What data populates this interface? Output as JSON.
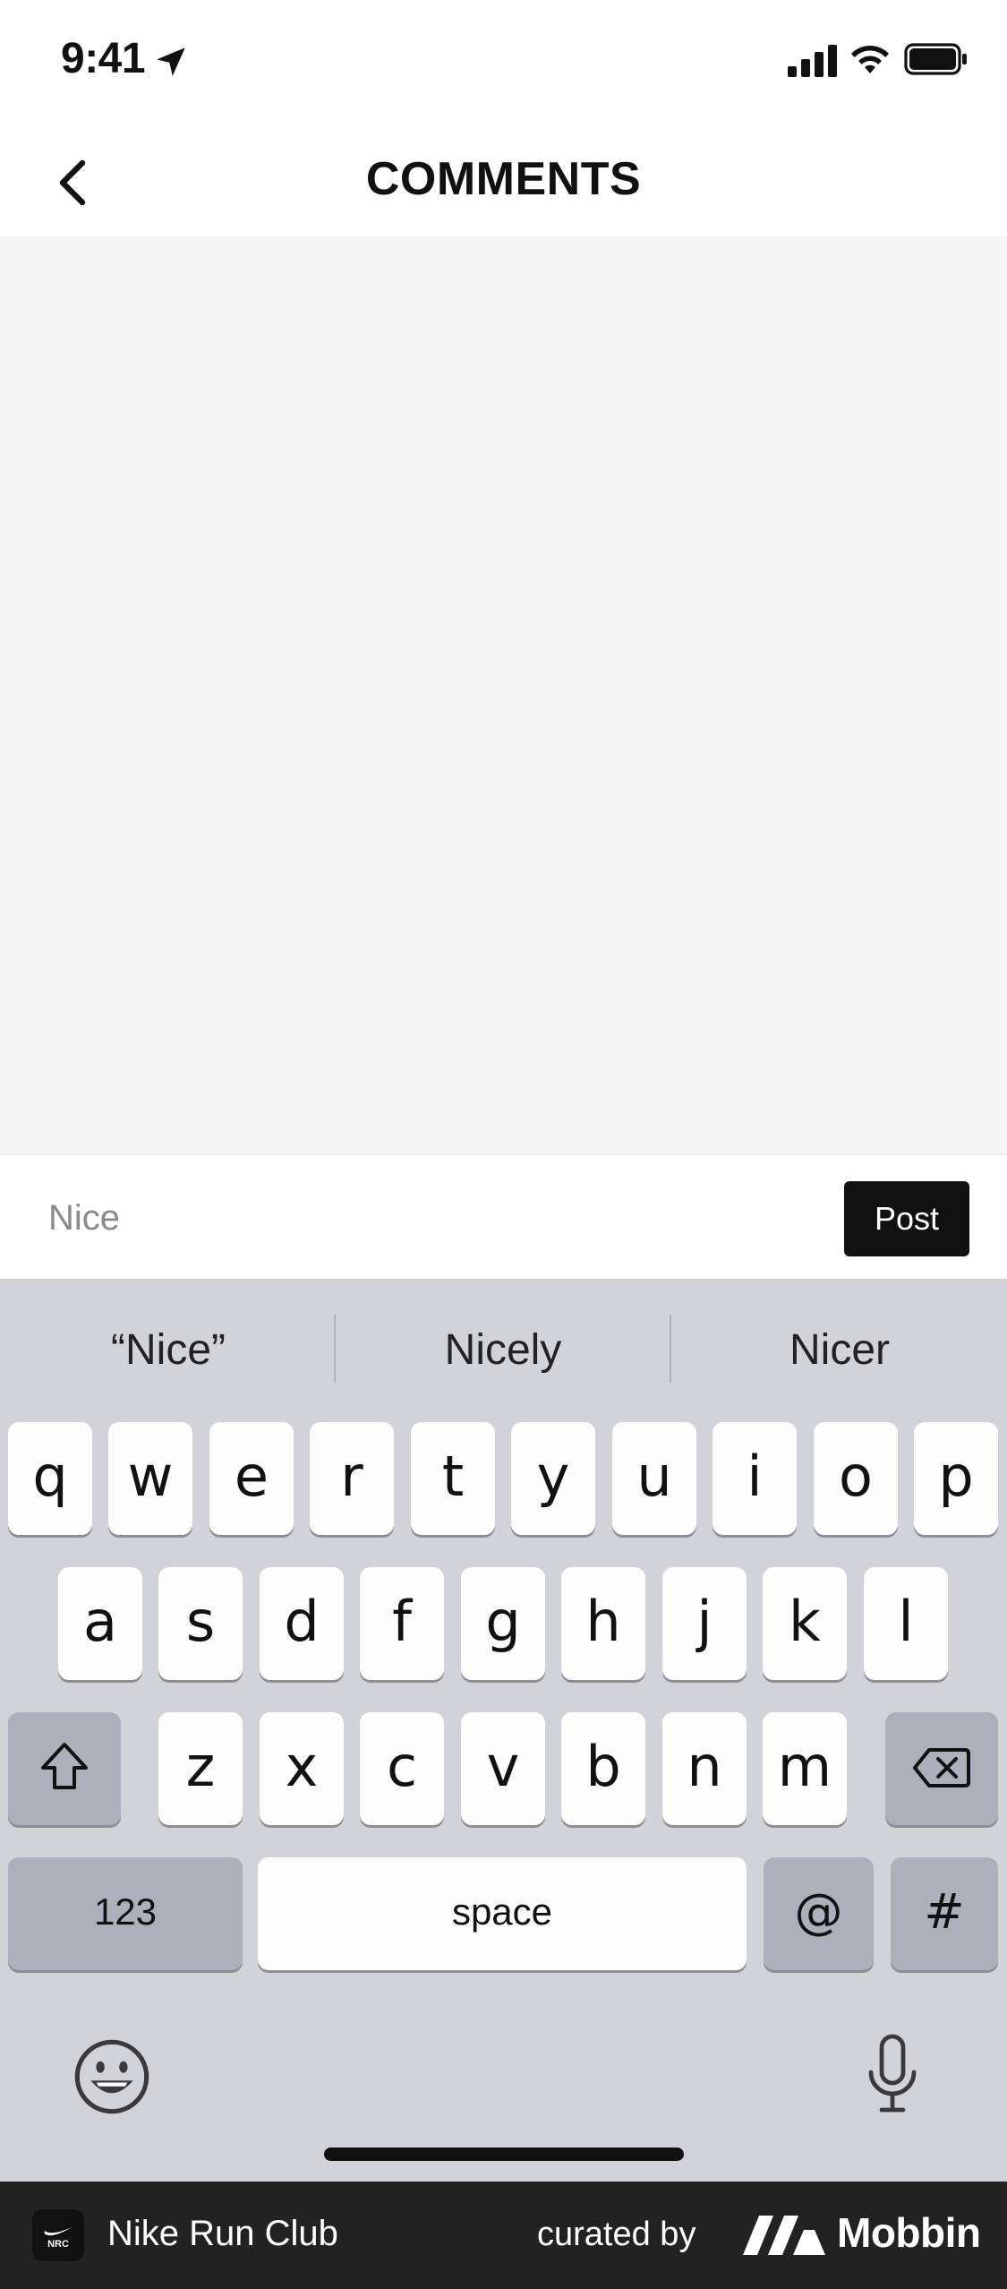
{
  "status_bar": {
    "time": "9:41",
    "icons": [
      "location-arrow-icon",
      "cellular-signal-icon",
      "wifi-icon",
      "battery-icon"
    ]
  },
  "nav": {
    "back_icon": "chevron-left-icon",
    "title": "COMMENTS"
  },
  "composer": {
    "input_value": "Nice",
    "post_label": "Post"
  },
  "keyboard": {
    "suggestions": [
      "“Nice”",
      "Nicely",
      "Nicer"
    ],
    "row1": [
      "q",
      "w",
      "e",
      "r",
      "t",
      "y",
      "u",
      "i",
      "o",
      "p"
    ],
    "row2": [
      "a",
      "s",
      "d",
      "f",
      "g",
      "h",
      "j",
      "k",
      "l"
    ],
    "row3": [
      "z",
      "x",
      "c",
      "v",
      "b",
      "n",
      "m"
    ],
    "shift_icon": "shift-arrow-icon",
    "delete_icon": "backspace-icon",
    "numbers_label": "123",
    "space_label": "space",
    "at_label": "@",
    "hash_label": "#",
    "emoji_icon": "emoji-face-icon",
    "mic_icon": "microphone-icon"
  },
  "footer": {
    "app_logo_text": "NRC",
    "app_name": "Nike Run Club",
    "curated_label": "curated by",
    "brand": "Mobbin"
  },
  "colors": {
    "post_button": "#111111",
    "comments_bg": "#f5f5f5",
    "keyboard_bg": "#d1d3d9",
    "footer_bg": "#222222"
  }
}
